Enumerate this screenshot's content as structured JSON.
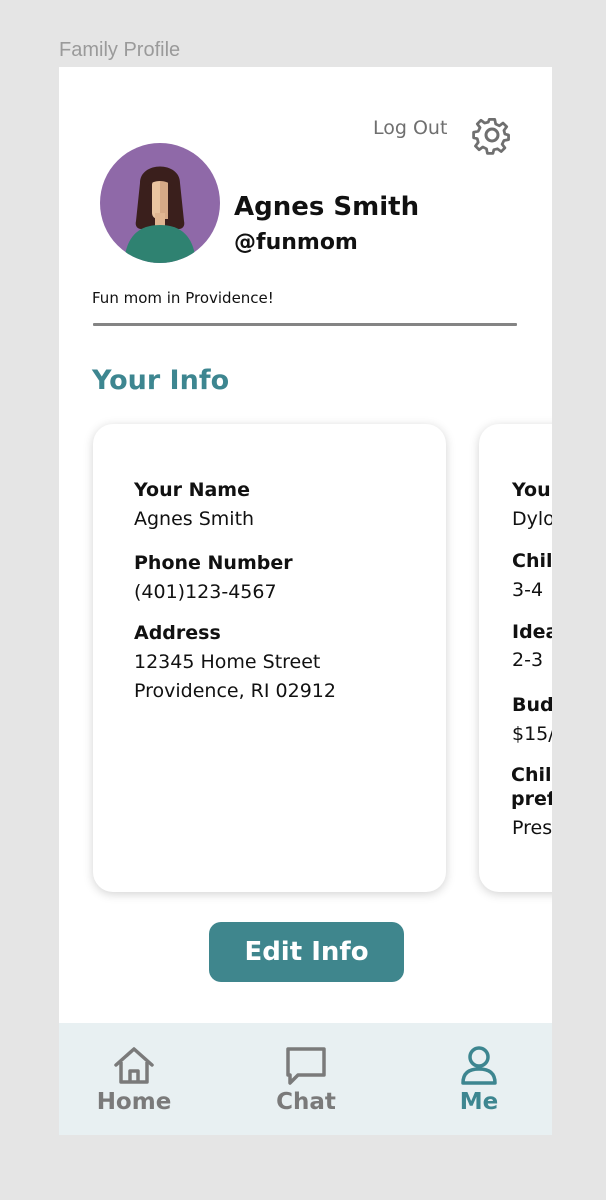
{
  "frame": {
    "label": "Family Profile"
  },
  "header": {
    "logout_label": "Log Out"
  },
  "profile": {
    "name": "Agnes Smith",
    "handle": "@funmom",
    "bio": "Fun mom in Providence!"
  },
  "section": {
    "title": "Your Info"
  },
  "card1": {
    "name_label": "Your Name",
    "name_value": "Agnes Smith",
    "phone_label": "Phone Number",
    "phone_value": "(401)123-4567",
    "address_label": "Address",
    "address_line1": "12345 Home Street",
    "address_line2": "Providence, RI 02912"
  },
  "card2": {
    "l1": "You",
    "v1": "Dylo",
    "l2": "Chil",
    "v2": "3-4",
    "l3": "Idea",
    "v3": "2-3",
    "l4": "Bud",
    "v4": "$15/",
    "l5a": "Chil",
    "l5b": "pref",
    "v5": "Pres"
  },
  "actions": {
    "edit_label": "Edit Info"
  },
  "nav": {
    "home": "Home",
    "chat": "Chat",
    "me": "Me"
  },
  "colors": {
    "accent": "#3d8690",
    "button": "#3f868d",
    "avatar_bg": "#8f69a8",
    "nav_bg": "#e8f0f2"
  }
}
